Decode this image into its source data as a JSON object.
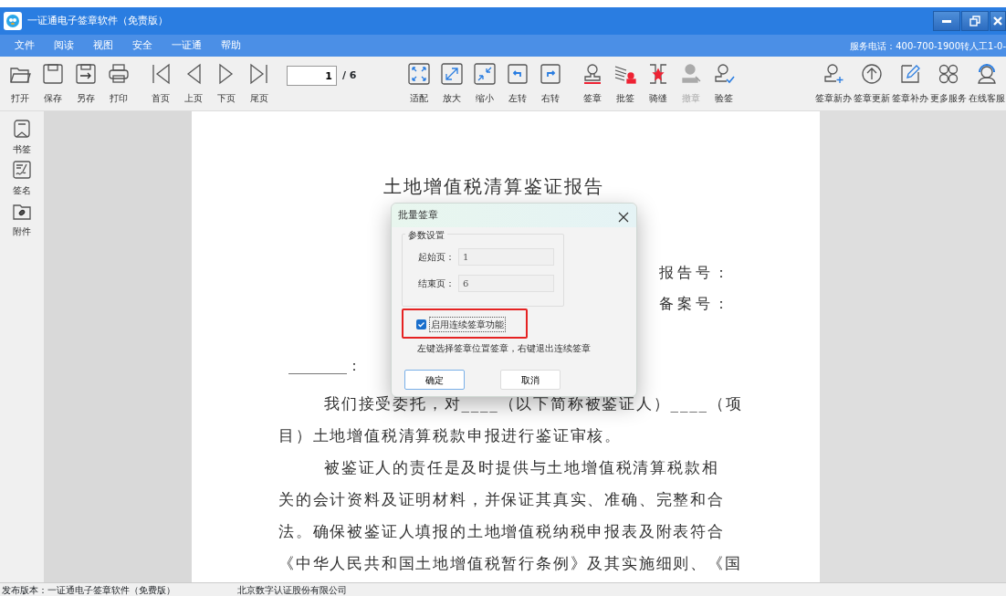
{
  "window": {
    "title": "一证通电子签章软件（免责版）"
  },
  "menu": {
    "items": [
      "文件",
      "阅读",
      "视图",
      "安全",
      "一证通",
      "帮助"
    ],
    "service_phone": "服务电话：400-700-1900转人工1-0-"
  },
  "toolbar": {
    "file_buttons": [
      {
        "label": "打开",
        "disabled": false
      },
      {
        "label": "保存",
        "disabled": false
      },
      {
        "label": "另存",
        "disabled": false
      },
      {
        "label": "打印",
        "disabled": false
      }
    ],
    "nav_buttons": [
      {
        "label": "首页",
        "disabled": false
      },
      {
        "label": "上页",
        "disabled": false
      },
      {
        "label": "下页",
        "disabled": false
      },
      {
        "label": "尾页",
        "disabled": false
      }
    ],
    "pager": {
      "value": "1",
      "total": "/ 6"
    },
    "view_buttons": [
      {
        "label": "适配",
        "disabled": false
      },
      {
        "label": "放大",
        "disabled": false
      },
      {
        "label": "缩小",
        "disabled": false
      },
      {
        "label": "左转",
        "disabled": false
      },
      {
        "label": "右转",
        "disabled": false
      }
    ],
    "sign_buttons": [
      {
        "label": "签章",
        "disabled": false
      },
      {
        "label": "批签",
        "disabled": false
      },
      {
        "label": "骑缝",
        "disabled": false
      },
      {
        "label": "撤章",
        "disabled": true
      },
      {
        "label": "验签",
        "disabled": false
      }
    ],
    "service_buttons": [
      {
        "label": "签章新办",
        "disabled": false
      },
      {
        "label": "签章更新",
        "disabled": false
      },
      {
        "label": "签章补办",
        "disabled": false
      },
      {
        "label": "更多服务",
        "disabled": false
      },
      {
        "label": "在线客服",
        "disabled": false
      }
    ]
  },
  "sidebar": {
    "items": [
      "书签",
      "签名",
      "附件"
    ]
  },
  "document": {
    "title": "土地增值税清算鉴证报告",
    "report_no": "报告号：",
    "record_no": "备案号：",
    "addressee": "________：",
    "lines": [
      {
        "text": "我们接受委托，对____（以下简称被鉴证人）____（项",
        "indent": true
      },
      {
        "text": "目）土地增值税清算税款申报进行鉴证审核。",
        "indent": false
      },
      {
        "text": "被鉴证人的责任是及时提供与土地增值税清算税款相",
        "indent": true
      },
      {
        "text": "关的会计资料及证明材料，并保证其真实、准确、完整和合",
        "indent": false
      },
      {
        "text": "法。确保被鉴证人填报的土地增值税纳税申报表及附表符合",
        "indent": false
      },
      {
        "text": "《中华人民共和国土地增值税暂行条例》及其实施细则、《国",
        "indent": false
      }
    ]
  },
  "dialog": {
    "title": "批量签章",
    "group_title": "参数设置",
    "fields": [
      {
        "label": "起始页：",
        "value": "1"
      },
      {
        "label": "结束页：",
        "value": "6"
      }
    ],
    "option": {
      "label": "启用连续签章功能",
      "checked": true
    },
    "hint": "左键选择签章位置签章，右键退出连续签章",
    "buttons": [
      "确定",
      "取消"
    ]
  },
  "status_bar": {
    "version": "发布版本：一证通电子签章软件（免费版）",
    "company": "北京数字认证股份有限公司"
  }
}
